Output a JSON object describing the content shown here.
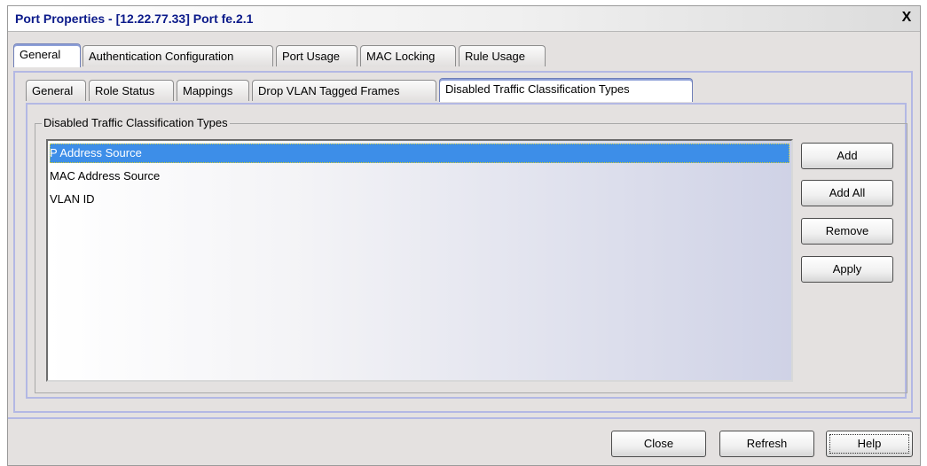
{
  "window": {
    "title": "Port Properties - [12.22.77.33] Port fe.2.1",
    "close_label": "X"
  },
  "top_tabs": [
    {
      "label": "General",
      "active": true
    },
    {
      "label": "Authentication Configuration",
      "active": false
    },
    {
      "label": "Port Usage",
      "active": false
    },
    {
      "label": "MAC Locking",
      "active": false
    },
    {
      "label": "Rule Usage",
      "active": false
    }
  ],
  "sub_tabs": [
    {
      "label": "General",
      "active": false
    },
    {
      "label": "Role Status",
      "active": false
    },
    {
      "label": "Mappings",
      "active": false
    },
    {
      "label": "Drop VLAN Tagged Frames",
      "active": false
    },
    {
      "label": "Disabled Traffic Classification Types",
      "active": true
    }
  ],
  "group": {
    "title": "Disabled Traffic Classification Types",
    "items": [
      {
        "label": "P Address Source",
        "selected": true
      },
      {
        "label": "MAC Address Source",
        "selected": false
      },
      {
        "label": "VLAN ID",
        "selected": false
      }
    ]
  },
  "side_buttons": {
    "add": "Add",
    "add_all": "Add All",
    "remove": "Remove",
    "apply": "Apply"
  },
  "footer_buttons": {
    "close": "Close",
    "refresh": "Refresh",
    "help": "Help"
  },
  "colors": {
    "title_text": "#0b1a8a",
    "selection": "#3d8ee8",
    "panel_border": "#b3b8e4",
    "window_bg": "#e4e1e0"
  }
}
